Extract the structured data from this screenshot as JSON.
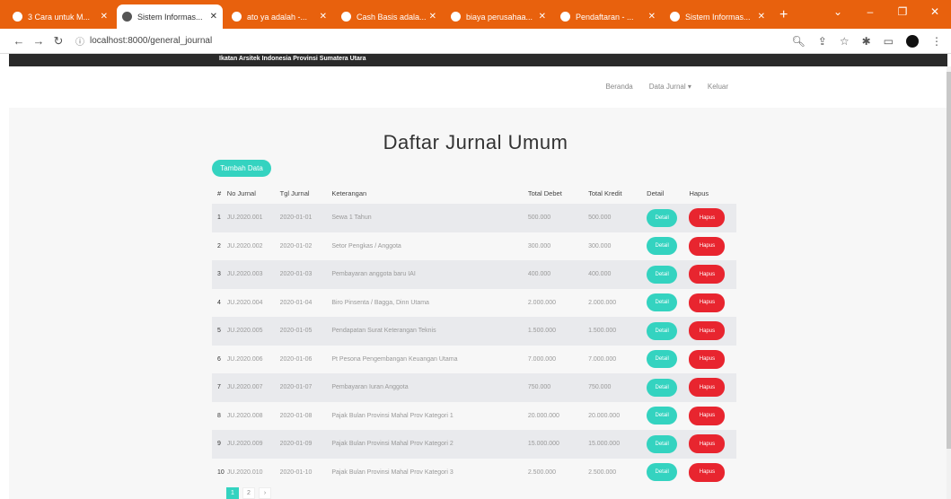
{
  "browser": {
    "tabs": [
      {
        "title": "3 Cara untuk M..."
      },
      {
        "title": "Sistem Informas..."
      },
      {
        "title": "ato ya adalah -..."
      },
      {
        "title": "Cash Basis adala..."
      },
      {
        "title": "biaya perusahaa..."
      },
      {
        "title": "Pendaftaran - ..."
      },
      {
        "title": "Sistem Informas..."
      }
    ],
    "new_tab": "+",
    "url": "localhost:8000/general_journal"
  },
  "app": {
    "brand": "Ikatan Arsitek Indonesia Provinsi Sumatera Utara",
    "nav": [
      "Beranda",
      "Data Jurnal ▾",
      "Keluar"
    ],
    "page_title": "Daftar Jurnal Umum",
    "add_button": "Tambah Data"
  },
  "table": {
    "headers": [
      "#",
      "No Jurnal",
      "Tgl Jurnal",
      "Keterangan",
      "Total Debet",
      "Total Kredit",
      "Detail",
      "Hapus"
    ],
    "detail_label": "Detail",
    "delete_label": "Hapus",
    "rows": [
      [
        "1",
        "JU.2020.001",
        "2020-01-01",
        "Sewa 1 Tahun",
        "500.000",
        "500.000"
      ],
      [
        "2",
        "JU.2020.002",
        "2020-01-02",
        "Setor Pengkas / Anggota",
        "300.000",
        "300.000"
      ],
      [
        "3",
        "JU.2020.003",
        "2020-01-03",
        "Pembayaran anggota baru IAI",
        "400.000",
        "400.000"
      ],
      [
        "4",
        "JU.2020.004",
        "2020-01-04",
        "Biro Pinsenta / Bagga, Dinn Utama",
        "2.000.000",
        "2.000.000"
      ],
      [
        "5",
        "JU.2020.005",
        "2020-01-05",
        "Pendapatan Surat Keterangan Teknis",
        "1.500.000",
        "1.500.000"
      ],
      [
        "6",
        "JU.2020.006",
        "2020-01-06",
        "Pt Pesona Pengembangan Keuangan Utama",
        "7.000.000",
        "7.000.000"
      ],
      [
        "7",
        "JU.2020.007",
        "2020-01-07",
        "Pembayaran Iuran Anggota",
        "750.000",
        "750.000"
      ],
      [
        "8",
        "JU.2020.008",
        "2020-01-08",
        "Pajak Bulan Provinsi Mahal Prov Kategori 1",
        "20.000.000",
        "20.000.000"
      ],
      [
        "9",
        "JU.2020.009",
        "2020-01-09",
        "Pajak Bulan Provinsi Mahal Prov Kategori 2",
        "15.000.000",
        "15.000.000"
      ],
      [
        "10",
        "JU.2020.010",
        "2020-01-10",
        "Pajak Bulan Provinsi Mahal Prov Kategori 3",
        "2.500.000",
        "2.500.000"
      ]
    ]
  },
  "pagination": [
    "1",
    "2",
    "›"
  ]
}
